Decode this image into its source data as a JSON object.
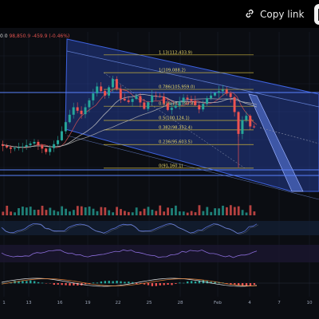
{
  "header": {
    "copy_link_label": "Copy link"
  },
  "readout": {
    "prefix": "0.0",
    "price": "98,850.9",
    "change": "-459.9 (-0.46%)"
  },
  "colors": {
    "bg": "#0b0d12",
    "grid": "#1a1f2b",
    "channel_fill": "#2a49b8",
    "channel_line": "#3f63e0",
    "up": "#26a69a",
    "down": "#ef5350",
    "fib_line": "#c8b13a",
    "fib_text": "#e8d76a",
    "rsi": "#5b73d6",
    "stoch": "#8a6cd8",
    "macd_line": "#e8e8e8",
    "signal_line": "#e0813a"
  },
  "chart_data": {
    "type": "line",
    "title": "",
    "xlabel": "",
    "ylabel": "",
    "x_ticks": [
      "1",
      "13",
      "16",
      "19",
      "22",
      "25",
      "28",
      "Feb",
      "4",
      "7",
      "10"
    ],
    "price_ylim": [
      88000,
      116000
    ],
    "price_approx": [
      [
        0,
        95600
      ],
      [
        3,
        94800
      ],
      [
        6,
        95200
      ],
      [
        9,
        96100
      ],
      [
        12,
        94200
      ],
      [
        15,
        96400
      ],
      [
        17,
        99800
      ],
      [
        19,
        102600
      ],
      [
        21,
        101300
      ],
      [
        23,
        103900
      ],
      [
        25,
        106500
      ],
      [
        27,
        104800
      ],
      [
        29,
        107900
      ],
      [
        31,
        104200
      ],
      [
        33,
        103600
      ],
      [
        35,
        104700
      ],
      [
        37,
        102300
      ],
      [
        39,
        104800
      ],
      [
        41,
        104600
      ],
      [
        43,
        102100
      ],
      [
        45,
        102900
      ],
      [
        47,
        104400
      ],
      [
        49,
        103800
      ],
      [
        51,
        102200
      ],
      [
        53,
        104300
      ],
      [
        55,
        105300
      ],
      [
        57,
        105900
      ],
      [
        59,
        104500
      ],
      [
        60,
        101700
      ],
      [
        61,
        97600
      ],
      [
        62,
        100200
      ],
      [
        63,
        101000
      ],
      [
        64,
        99000
      ],
      [
        65,
        98850
      ]
    ],
    "fib_levels": [
      {
        "ratio": "1.13",
        "value": "112,433.9",
        "label": "1.13(112,433.9)"
      },
      {
        "ratio": "1",
        "value": "109,088.2",
        "label": "1(109,088.2)"
      },
      {
        "ratio": "0.786",
        "value": "105,959.0",
        "label": "0.786(105,959.0)"
      },
      {
        "ratio": "0.618",
        "value": "102,793.8",
        "label": "0.618(102,793.8)"
      },
      {
        "ratio": "0.5",
        "value": "100,124.1",
        "label": "0.5(100,124.1)"
      },
      {
        "ratio": "0.382",
        "value": "98,352.4",
        "label": "0.382(98,352.4)"
      },
      {
        "ratio": "0.236",
        "value": "95,603.5",
        "label": "0.236(95,603.5)"
      },
      {
        "ratio": "0",
        "value": "91,160.1",
        "label": "0(91,160.1)"
      }
    ],
    "indicators": [
      "volume",
      "rsi",
      "stoch_rsi",
      "macd"
    ],
    "grid": true
  }
}
